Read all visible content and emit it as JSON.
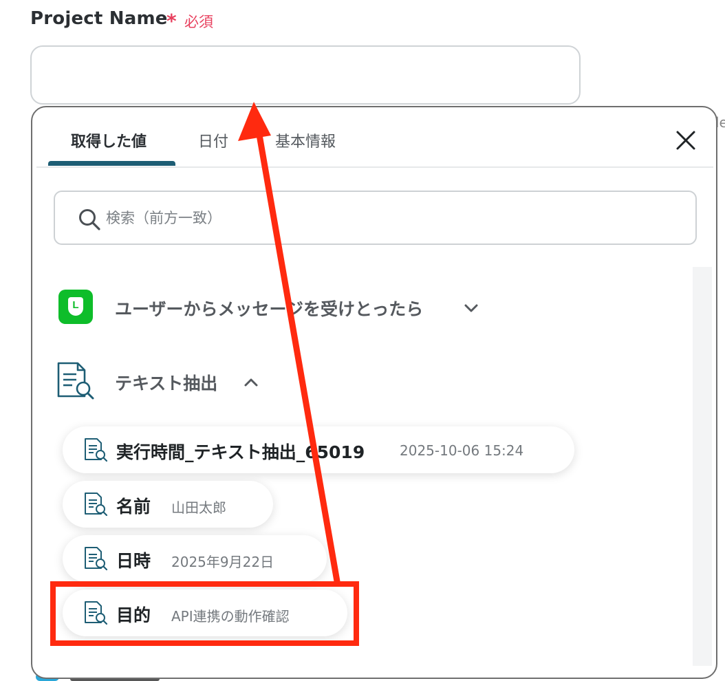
{
  "field": {
    "label": "Project Name",
    "required_mark": "*",
    "required_text": "必須",
    "value": ""
  },
  "background": {
    "cut_text": "le"
  },
  "tabs": [
    {
      "label": "取得した値",
      "active": true
    },
    {
      "label": "日付",
      "active": false
    },
    {
      "label": "基本情報",
      "active": false
    }
  ],
  "search": {
    "placeholder": "検索（前方一致）",
    "value": ""
  },
  "groups": [
    {
      "label": "ユーザーからメッセージを受けとったら",
      "icon": "line-app-icon",
      "expanded": false
    },
    {
      "label": "テキスト抽出",
      "icon": "document-search-icon",
      "expanded": true
    }
  ],
  "items": [
    {
      "name": "実行時間_テキスト抽出_65019",
      "value": "2025-10-06 15:24"
    },
    {
      "name": "名前",
      "value": "山田太郎"
    },
    {
      "name": "日時",
      "value": "2025年9月22日"
    },
    {
      "name": "目的",
      "value": "API連携の動作確認"
    }
  ],
  "colors": {
    "accent": "#1d5d74",
    "required": "#e8415f",
    "annotation": "#ff2a0f",
    "line_green": "#0ebd2a"
  }
}
